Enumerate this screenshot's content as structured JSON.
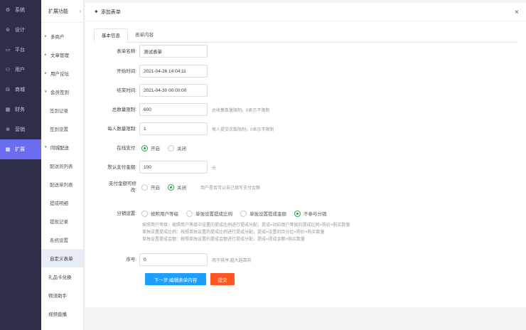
{
  "nav": {
    "items": [
      {
        "icon": "⚙",
        "label": "系统"
      },
      {
        "icon": "⊜",
        "label": "设计"
      },
      {
        "icon": "▭",
        "label": "平台"
      },
      {
        "icon": "⚇",
        "label": "用户"
      },
      {
        "icon": "⊟",
        "label": "商城"
      },
      {
        "icon": "▦",
        "label": "财务"
      },
      {
        "icon": "⊕",
        "label": "营销"
      },
      {
        "icon": "▩",
        "label": "扩展"
      }
    ]
  },
  "subnav": {
    "title": "扩展功能",
    "collapse": "‹",
    "items": [
      {
        "text": "多商户",
        "tri": "▸"
      },
      {
        "text": "文章管理",
        "tri": "▸"
      },
      {
        "text": "用户论坛",
        "tri": "▸"
      },
      {
        "text": "会员签到",
        "tri": "▾"
      },
      {
        "text": "签到记录"
      },
      {
        "text": "签到设置"
      },
      {
        "text": "同城配送",
        "tri": "▾"
      },
      {
        "text": "配送员列表"
      },
      {
        "text": "配送单列表"
      },
      {
        "text": "提成明细"
      },
      {
        "text": "提现记录"
      },
      {
        "text": "系统设置"
      },
      {
        "text": "自定义表单"
      },
      {
        "text": "礼品卡兑换"
      },
      {
        "text": "物流助手"
      },
      {
        "text": "视频直播"
      }
    ]
  },
  "panel": {
    "title": "添加表单",
    "plus": "✦",
    "close": "×"
  },
  "tabs": [
    "基本信息",
    "表单内容"
  ],
  "form": {
    "name": {
      "label": "表单名称:",
      "value": "测试表单"
    },
    "start": {
      "label": "开始时间:",
      "value": "2021-04-26 14:04:11"
    },
    "end": {
      "label": "结束时间:",
      "value": "2021-04-30 00:00:00"
    },
    "total": {
      "label": "总数量限制:",
      "value": "600",
      "hint": "总收集数量限制，0表示不限制"
    },
    "per": {
      "label": "每人数量限制:",
      "value": "1",
      "hint": "每人提交次数限制，0表示不限制"
    },
    "online_pay": {
      "label": "在线支付:",
      "opt1": "开启",
      "opt2": "关闭"
    },
    "amount": {
      "label": "默认支付金额:",
      "value": "100",
      "hint": "元"
    },
    "modifiable": {
      "label1": "支付金额可修",
      "label2": "改:",
      "opt1": "开启",
      "opt2": "关闭",
      "hint": "用户是否可以自己填写支付金额"
    },
    "commission": {
      "label": "分销设置:",
      "opt1": "按照用户等级",
      "opt2": "单独设置提成比例",
      "opt3": "单独设置提成金额",
      "opt4": "不参与分销"
    },
    "notes": [
      "按照用户等级：按照用户等级中设置的提成比例进行提成分配，提成=对应用户等级的提成比例×购价×购买数量",
      "单独设置提成比例：按照单独设置的提成比例进行提成分配，提成=设置的百分比×购价×购买数量",
      "单独设置提成金额：按照单独设置的提成金额进行提成分配，提成=提成金额×购买数量"
    ],
    "sort": {
      "label": "序号:",
      "value": "0",
      "hint": "用于排序,越大越靠前"
    }
  },
  "buttons": {
    "next": "下一步:编辑表单内容",
    "submit": "提交"
  }
}
